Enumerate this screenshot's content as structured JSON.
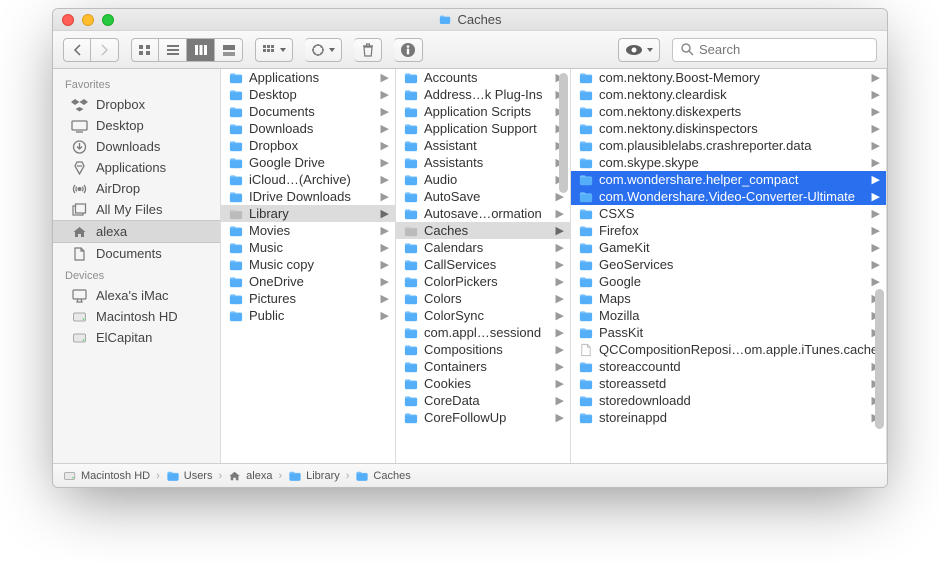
{
  "window_title": "Caches",
  "search_placeholder": "Search",
  "sidebar": {
    "sections": [
      {
        "head": "Favorites",
        "items": [
          {
            "icon": "dropbox",
            "label": "Dropbox"
          },
          {
            "icon": "desktop",
            "label": "Desktop"
          },
          {
            "icon": "downloads",
            "label": "Downloads"
          },
          {
            "icon": "apps",
            "label": "Applications"
          },
          {
            "icon": "airdrop",
            "label": "AirDrop"
          },
          {
            "icon": "allfiles",
            "label": "All My Files"
          },
          {
            "icon": "home",
            "label": "alexa",
            "sel": true
          },
          {
            "icon": "docs",
            "label": "Documents"
          }
        ]
      },
      {
        "head": "Devices",
        "items": [
          {
            "icon": "imac",
            "label": "Alexa's iMac"
          },
          {
            "icon": "hd",
            "label": "Macintosh HD"
          },
          {
            "icon": "hd",
            "label": "ElCapitan"
          }
        ]
      }
    ]
  },
  "columns": [
    {
      "width": "col0",
      "items": [
        {
          "t": "folder",
          "label": "Applications",
          "arrow": true
        },
        {
          "t": "folder",
          "label": "Desktop",
          "arrow": true
        },
        {
          "t": "folder",
          "label": "Documents",
          "arrow": true
        },
        {
          "t": "folder",
          "label": "Downloads",
          "arrow": true
        },
        {
          "t": "folder",
          "label": "Dropbox",
          "arrow": true
        },
        {
          "t": "folder",
          "label": "Google Drive",
          "arrow": true
        },
        {
          "t": "folder",
          "label": "iCloud…(Archive)",
          "arrow": true
        },
        {
          "t": "folder",
          "label": "IDrive Downloads",
          "arrow": true
        },
        {
          "t": "folder",
          "label": "Library",
          "arrow": true,
          "active": true
        },
        {
          "t": "folder",
          "label": "Movies",
          "arrow": true
        },
        {
          "t": "folder",
          "label": "Music",
          "arrow": true
        },
        {
          "t": "folder",
          "label": "Music copy",
          "arrow": true
        },
        {
          "t": "folder",
          "label": "OneDrive",
          "arrow": true
        },
        {
          "t": "folder",
          "label": "Pictures",
          "arrow": true
        },
        {
          "t": "folder",
          "label": "Public",
          "arrow": true
        }
      ]
    },
    {
      "width": "col1",
      "items": [
        {
          "t": "folder",
          "label": "Accounts",
          "arrow": true
        },
        {
          "t": "folder",
          "label": "Address…k Plug-Ins",
          "arrow": true
        },
        {
          "t": "folder",
          "label": "Application Scripts",
          "arrow": true
        },
        {
          "t": "folder",
          "label": "Application Support",
          "arrow": true
        },
        {
          "t": "folder",
          "label": "Assistant",
          "arrow": true
        },
        {
          "t": "folder",
          "label": "Assistants",
          "arrow": true
        },
        {
          "t": "folder",
          "label": "Audio",
          "arrow": true
        },
        {
          "t": "folder",
          "label": "AutoSave",
          "arrow": true
        },
        {
          "t": "folder",
          "label": "Autosave…ormation",
          "arrow": true
        },
        {
          "t": "folder",
          "label": "Caches",
          "arrow": true,
          "active": true
        },
        {
          "t": "folder",
          "label": "Calendars",
          "arrow": true
        },
        {
          "t": "folder",
          "label": "CallServices",
          "arrow": true
        },
        {
          "t": "folder",
          "label": "ColorPickers",
          "arrow": true
        },
        {
          "t": "folder",
          "label": "Colors",
          "arrow": true
        },
        {
          "t": "folder",
          "label": "ColorSync",
          "arrow": true
        },
        {
          "t": "folder",
          "label": "com.appl…sessiond",
          "arrow": true
        },
        {
          "t": "folder",
          "label": "Compositions",
          "arrow": true
        },
        {
          "t": "folder",
          "label": "Containers",
          "arrow": true
        },
        {
          "t": "folder",
          "label": "Cookies",
          "arrow": true
        },
        {
          "t": "folder",
          "label": "CoreData",
          "arrow": true
        },
        {
          "t": "folder",
          "label": "CoreFollowUp",
          "arrow": true
        }
      ]
    },
    {
      "width": "col2",
      "items": [
        {
          "t": "folder",
          "label": "com.nektony.Boost-Memory",
          "arrow": true
        },
        {
          "t": "folder",
          "label": "com.nektony.cleardisk",
          "arrow": true
        },
        {
          "t": "folder",
          "label": "com.nektony.diskexperts",
          "arrow": true
        },
        {
          "t": "folder",
          "label": "com.nektony.diskinspectors",
          "arrow": true
        },
        {
          "t": "folder",
          "label": "com.plausiblelabs.crashreporter.data",
          "arrow": true
        },
        {
          "t": "folder",
          "label": "com.skype.skype",
          "arrow": true
        },
        {
          "t": "folder",
          "label": "com.wondershare.helper_compact",
          "arrow": true,
          "sel": true
        },
        {
          "t": "folder",
          "label": "com.Wondershare.Video-Converter-Ultimate",
          "arrow": true,
          "sel": true
        },
        {
          "t": "folder",
          "label": "CSXS",
          "arrow": true
        },
        {
          "t": "folder",
          "label": "Firefox",
          "arrow": true
        },
        {
          "t": "folder",
          "label": "GameKit",
          "arrow": true
        },
        {
          "t": "folder",
          "label": "GeoServices",
          "arrow": true
        },
        {
          "t": "folder",
          "label": "Google",
          "arrow": true
        },
        {
          "t": "folder",
          "label": "Maps",
          "arrow": true
        },
        {
          "t": "folder",
          "label": "Mozilla",
          "arrow": true
        },
        {
          "t": "folder",
          "label": "PassKit",
          "arrow": true
        },
        {
          "t": "file",
          "label": "QCCompositionReposi…om.apple.iTunes.cache",
          "arrow": false
        },
        {
          "t": "folder",
          "label": "storeaccountd",
          "arrow": true
        },
        {
          "t": "folder",
          "label": "storeassetd",
          "arrow": true
        },
        {
          "t": "folder",
          "label": "storedownloadd",
          "arrow": true
        },
        {
          "t": "folder",
          "label": "storeinappd",
          "arrow": true
        }
      ]
    }
  ],
  "path": [
    {
      "icon": "hd",
      "label": "Macintosh HD"
    },
    {
      "icon": "folder",
      "label": "Users"
    },
    {
      "icon": "home",
      "label": "alexa"
    },
    {
      "icon": "folder",
      "label": "Library"
    },
    {
      "icon": "folder",
      "label": "Caches"
    }
  ]
}
